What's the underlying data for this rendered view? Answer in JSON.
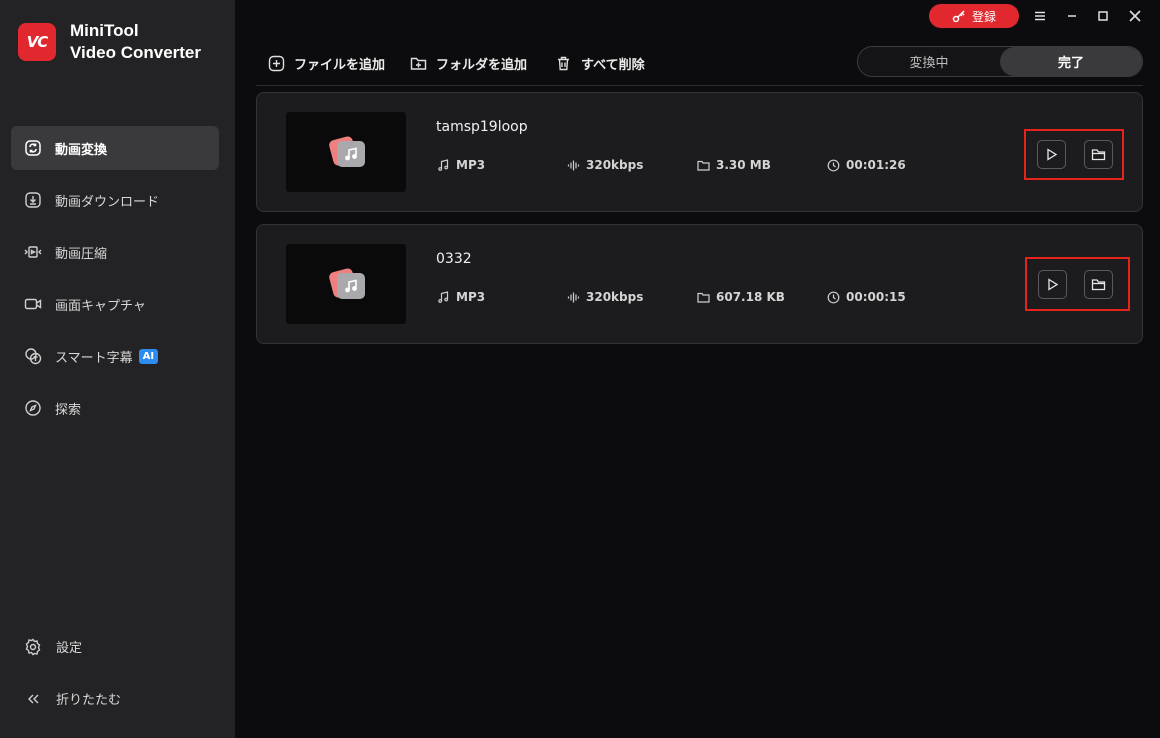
{
  "app": {
    "name_line1": "MiniTool",
    "name_line2": "Video Converter",
    "logo_text": "VC"
  },
  "sidebar": {
    "items": [
      {
        "label": "動画変換",
        "icon": "convert-icon",
        "active": true
      },
      {
        "label": "動画ダウンロード",
        "icon": "download-icon",
        "active": false
      },
      {
        "label": "動画圧縮",
        "icon": "compress-icon",
        "active": false
      },
      {
        "label": "画面キャプチャ",
        "icon": "camera-icon",
        "active": false
      },
      {
        "label": "スマート字幕",
        "icon": "subtitle-icon",
        "active": false,
        "badge": "AI"
      },
      {
        "label": "探索",
        "icon": "compass-icon",
        "active": false
      }
    ],
    "settings_label": "設定",
    "collapse_label": "折りたたむ"
  },
  "titlebar": {
    "register_label": "登録"
  },
  "toolbar": {
    "add_files": "ファイルを追加",
    "add_folder": "フォルダを追加",
    "delete_all": "すべて削除"
  },
  "tabs": {
    "converting": "変換中",
    "completed": "完了",
    "active": "completed"
  },
  "files": [
    {
      "name": "tamsp19loop",
      "format": "MP3",
      "bitrate": "320kbps",
      "size": "3.30 MB",
      "duration": "00:01:26"
    },
    {
      "name": "0332",
      "format": "MP3",
      "bitrate": "320kbps",
      "size": "607.18 KB",
      "duration": "00:00:15"
    }
  ],
  "colors": {
    "accent": "#e0282e",
    "highlight_box": "#e5231b",
    "sidebar_bg": "#232325",
    "main_bg": "#0c0c0e",
    "ai_badge": "#2d8cf0"
  }
}
